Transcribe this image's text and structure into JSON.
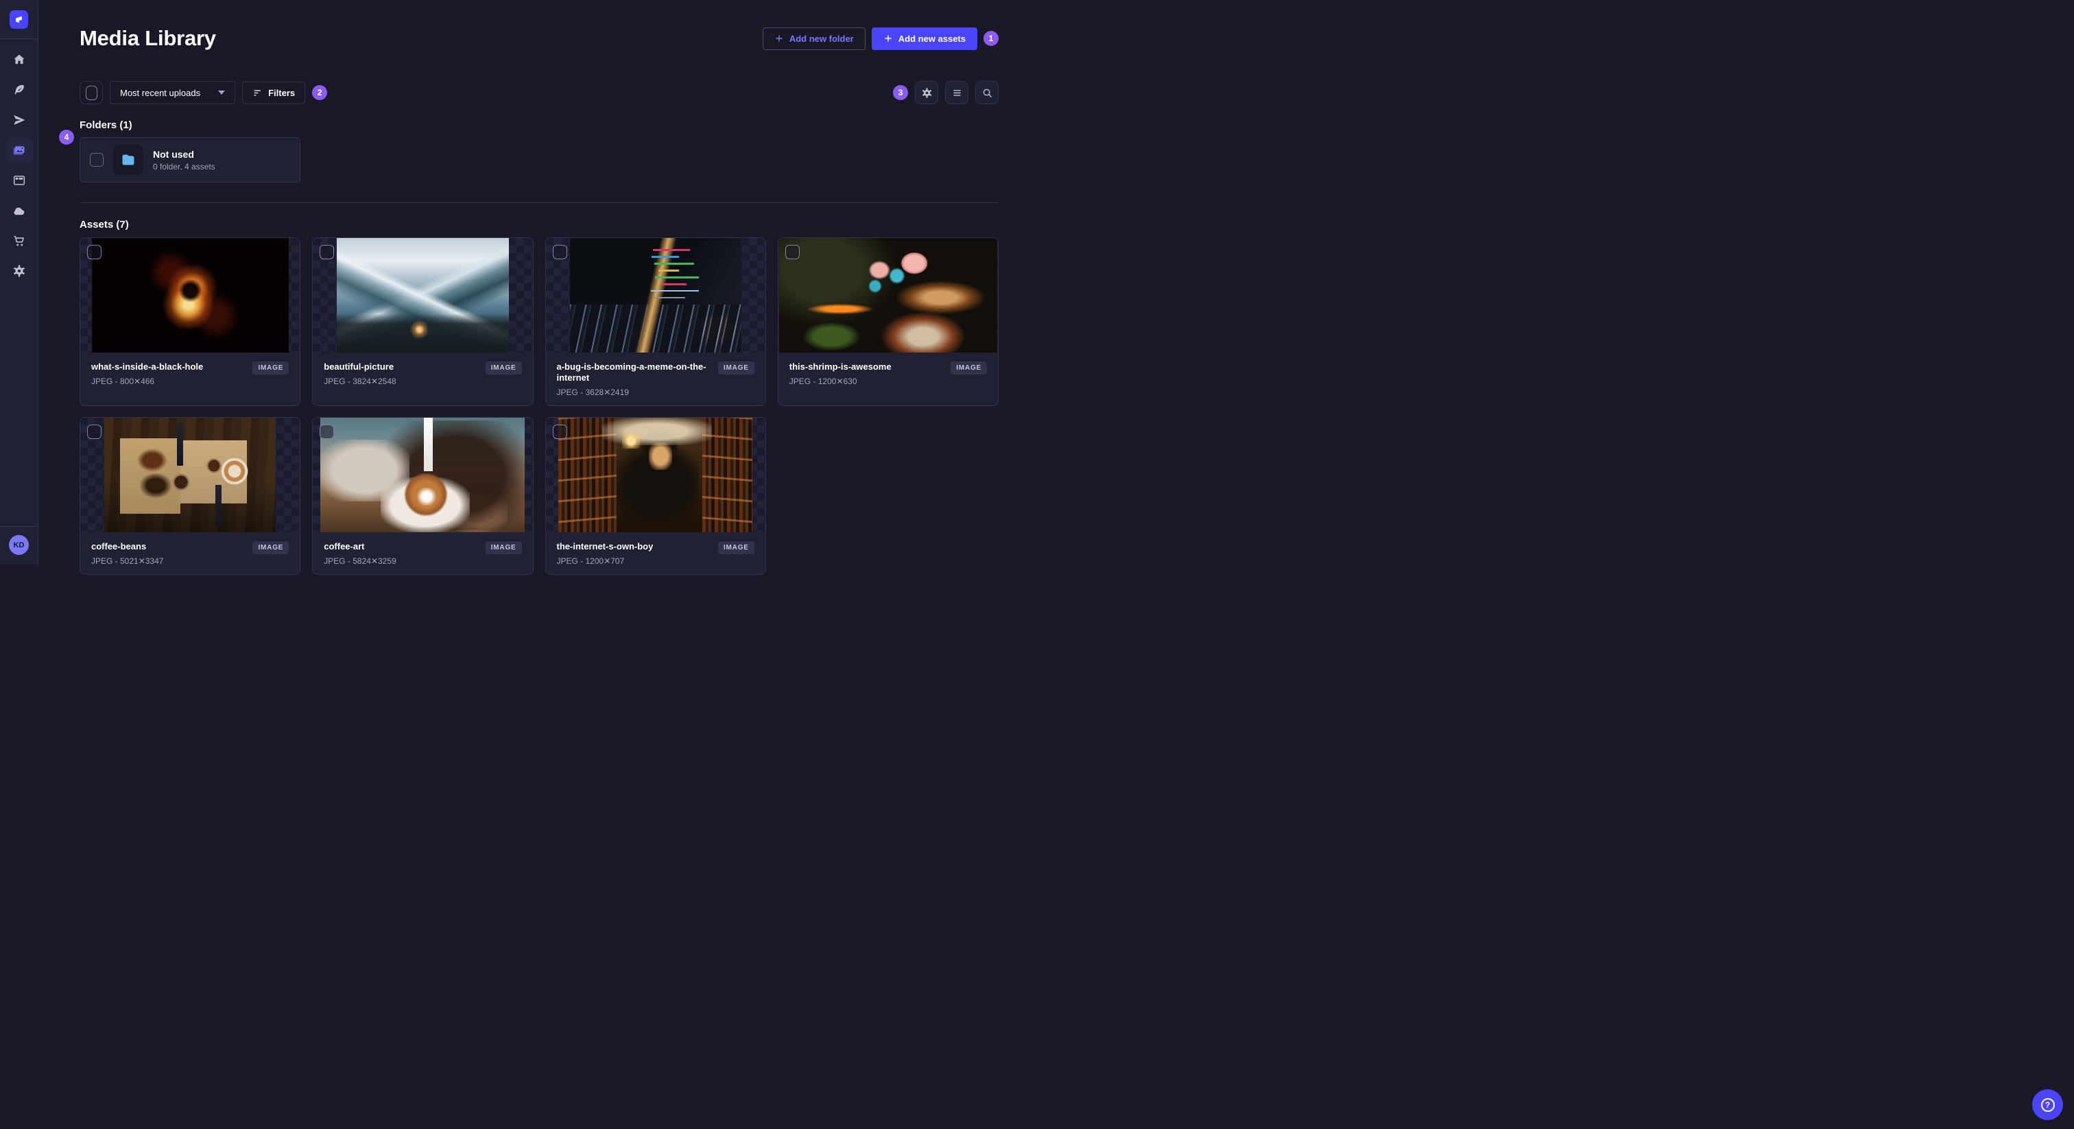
{
  "sidebar": {
    "logo_icon": "strapi-logo-icon",
    "nav_icons": [
      "home-icon",
      "feather-icon",
      "send-icon",
      "media-library-icon",
      "layout-icon",
      "cloud-icon",
      "cart-icon",
      "settings-icon"
    ],
    "active_item": "media-library",
    "avatar_initials": "KD"
  },
  "header": {
    "title": "Media Library",
    "add_folder_label": "Add new folder",
    "add_assets_label": "Add new assets",
    "add_assets_badge": "1"
  },
  "toolbar": {
    "sort_value": "Most recent uploads",
    "filters_label": "Filters",
    "filters_badge": "2",
    "settings_badge": "3",
    "view_icons": [
      "settings-icon",
      "list-icon",
      "search-icon"
    ]
  },
  "folders": {
    "heading": "Folders (1)",
    "badge": "4",
    "items": [
      {
        "name": "Not used",
        "meta": "0 folder, 4 assets",
        "icon": "folder-icon",
        "icon_color": "#66b7f1"
      }
    ]
  },
  "assets": {
    "heading": "Assets (7)",
    "items": [
      {
        "title": "what-s-inside-a-black-hole",
        "meta": "JPEG - 800✕466",
        "badge": "IMAGE",
        "image": "black-hole"
      },
      {
        "title": "beautiful-picture",
        "meta": "JPEG - 3824✕2548",
        "badge": "IMAGE",
        "image": "mountains"
      },
      {
        "title": "a-bug-is-becoming-a-meme-on-the-internet",
        "meta": "JPEG - 3628✕2419",
        "badge": "IMAGE",
        "image": "laptop-code"
      },
      {
        "title": "this-shrimp-is-awesome",
        "meta": "JPEG - 1200✕630",
        "badge": "IMAGE",
        "image": "mantis-shrimp"
      },
      {
        "title": "coffee-beans",
        "meta": "JPEG - 5021✕3347",
        "badge": "IMAGE",
        "image": "coffee-beans"
      },
      {
        "title": "coffee-art",
        "meta": "JPEG - 5824✕3259",
        "badge": "IMAGE",
        "image": "coffee-art"
      },
      {
        "title": "the-internet-s-own-boy",
        "meta": "JPEG - 1200✕707",
        "badge": "IMAGE",
        "image": "library-boy"
      }
    ]
  },
  "floating": {
    "help_icon": "question-icon",
    "help_glyph": "?"
  },
  "colors": {
    "accent": "#4945ff",
    "accent_light": "#7b79ff",
    "badge_purple": "#8a5cf5",
    "folder_blue": "#66b7f1",
    "background": "#181826",
    "surface": "#212134",
    "border": "#32324d",
    "text_secondary": "#a5a5ba"
  }
}
